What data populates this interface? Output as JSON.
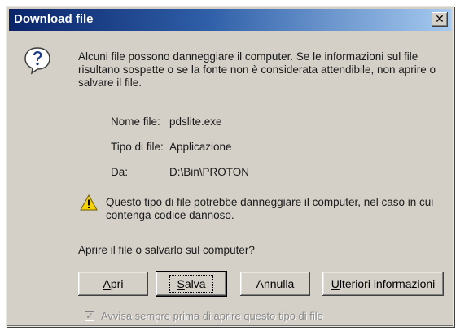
{
  "window": {
    "title": "Download file",
    "close_glyph": "✕"
  },
  "message": {
    "intro": "Alcuni file possono danneggiare il computer. Se le informazioni sul file risultano sospette o se la fonte non è considerata attendibile, non aprire o salvare il file.",
    "icon": "question-icon"
  },
  "file_info": {
    "name_label": "Nome file:",
    "name_value": "pdslite.exe",
    "type_label": "Tipo di file:",
    "type_value": "Applicazione",
    "from_label": "Da:",
    "from_value": "D:\\Bin\\PROTON"
  },
  "warning": {
    "icon": "warning-icon",
    "text": "Questo tipo di file potrebbe danneggiare il computer, nel caso in cui contenga codice dannoso."
  },
  "prompt": "Aprire il file o salvarlo sul computer?",
  "buttons": {
    "open_mnemonic": "A",
    "open_rest": "pri",
    "save_mnemonic": "S",
    "save_rest": "alva",
    "cancel": "Annulla",
    "more_mnemonic": "U",
    "more_rest": "lteriori informazioni"
  },
  "checkbox": {
    "checked": true,
    "label": "Avvisa sempre prima di aprire questo tipo di file"
  },
  "colors": {
    "titlebar_start": "#0a246a",
    "titlebar_end": "#a6caf0",
    "dialog_face": "#d4d0c8"
  }
}
